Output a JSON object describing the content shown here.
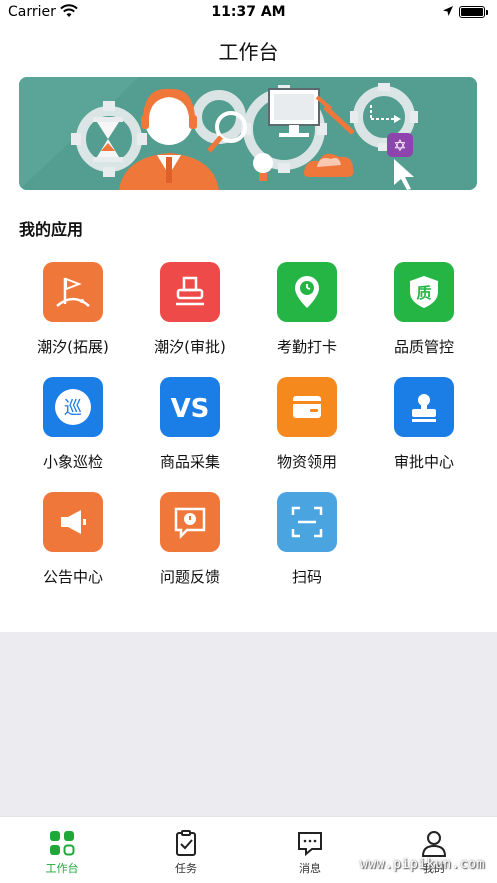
{
  "status_bar": {
    "carrier": "Carrier",
    "time": "11:37 AM"
  },
  "nav": {
    "title": "工作台"
  },
  "banner": {
    "badge_icon": "star-of-david-icon"
  },
  "section": {
    "title": "我的应用"
  },
  "apps": [
    {
      "label": "潮汐(拓展)",
      "color": "#f0773a",
      "icon": "flag-icon"
    },
    {
      "label": "潮汐(审批)",
      "color": "#ef4a4a",
      "icon": "stamp-icon"
    },
    {
      "label": "考勤打卡",
      "color": "#25b545",
      "icon": "location-clock-icon"
    },
    {
      "label": "品质管控",
      "color": "#25b545",
      "icon": "quality-shield-icon",
      "glyph": "质"
    },
    {
      "label": "小象巡检",
      "color": "#1a7ee6",
      "icon": "patrol-icon",
      "glyph": "巡"
    },
    {
      "label": "商品采集",
      "color": "#1a7ee6",
      "icon": "vs-icon",
      "glyph": "VS"
    },
    {
      "label": "物资领用",
      "color": "#f5891e",
      "icon": "wallet-icon"
    },
    {
      "label": "审批中心",
      "color": "#1a7ee6",
      "icon": "approval-stamp-icon"
    },
    {
      "label": "公告中心",
      "color": "#f0773a",
      "icon": "megaphone-icon"
    },
    {
      "label": "问题反馈",
      "color": "#f0773a",
      "icon": "feedback-icon"
    },
    {
      "label": "扫码",
      "color": "#4aa4e0",
      "icon": "scan-icon"
    }
  ],
  "tabs": [
    {
      "label": "工作台",
      "icon": "workbench-icon",
      "active": true
    },
    {
      "label": "任务",
      "icon": "task-clipboard-icon",
      "active": false
    },
    {
      "label": "消息",
      "icon": "message-icon",
      "active": false
    },
    {
      "label": "我的",
      "icon": "profile-icon",
      "active": false
    }
  ],
  "watermark": {
    "text": "www.pipikun.com"
  }
}
